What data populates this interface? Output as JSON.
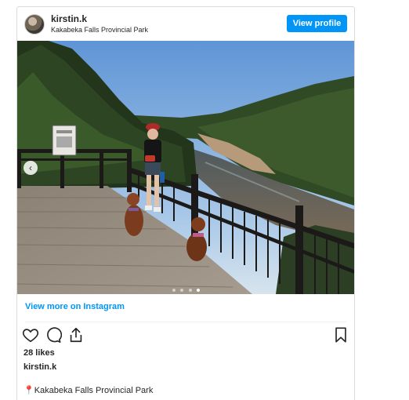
{
  "post": {
    "username": "kirstin.k",
    "location": "Kakabeka Falls Provincial Park",
    "view_profile_label": "View profile",
    "view_more_label": "View more on Instagram",
    "likes_text": "28 likes",
    "caption_owner": "kirstin.k",
    "caption_pin": "📍",
    "caption_text": "Kakabeka Falls Provincial Park",
    "carousel": {
      "total": 4,
      "current": 4
    }
  },
  "icons": {
    "like": "heart-icon",
    "comment": "comment-icon",
    "share": "share-icon",
    "save": "bookmark-icon",
    "prev": "chevron-left-icon"
  },
  "colors": {
    "accent": "#0095f6",
    "text": "#262626",
    "border": "#dbdbdb"
  }
}
